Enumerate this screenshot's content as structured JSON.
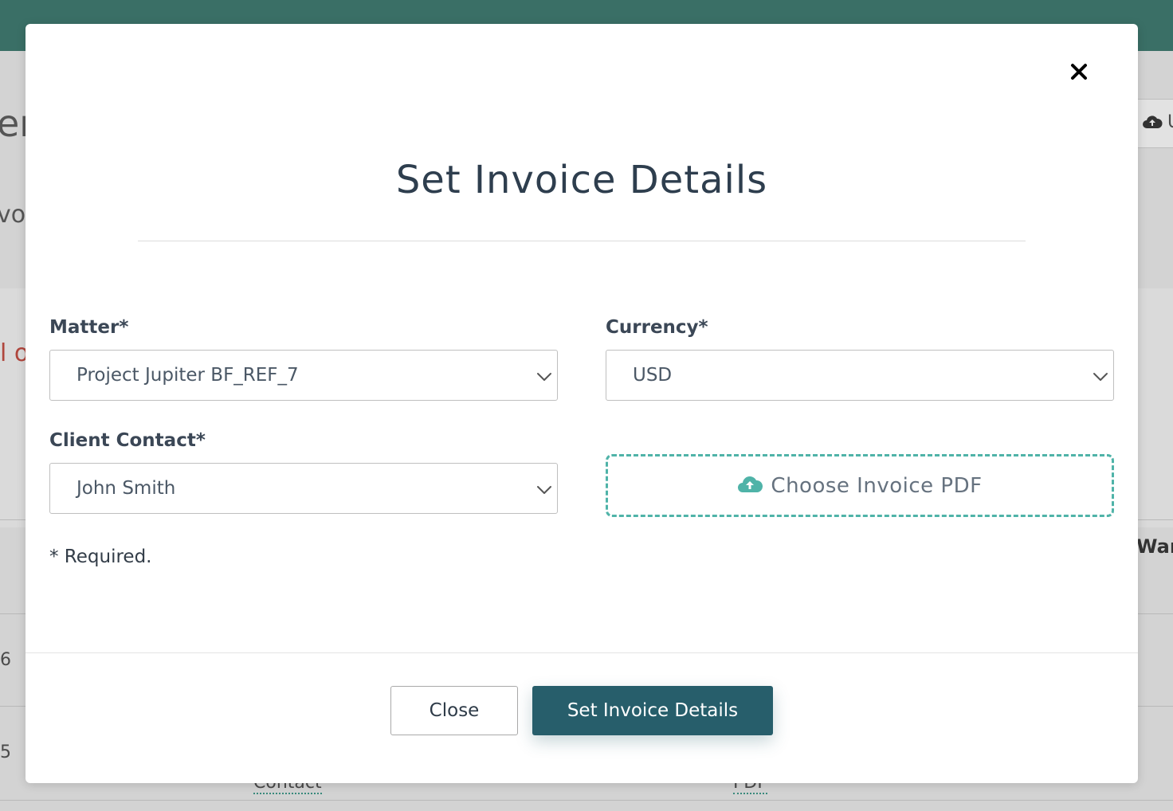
{
  "background": {
    "fragments": [
      "er",
      "vo",
      "l o",
      "Warr",
      "6",
      "5",
      "Contact",
      "PDF"
    ],
    "upload_fragment": "U"
  },
  "modal": {
    "title": "Set Invoice Details",
    "matter": {
      "label": "Matter*",
      "value": "Project Jupiter BF_REF_7"
    },
    "currency": {
      "label": "Currency*",
      "value": "USD"
    },
    "client_contact": {
      "label": "Client Contact*",
      "value": "John Smith"
    },
    "upload": {
      "label": "Choose Invoice PDF",
      "icon": "cloud-upload-icon"
    },
    "required_note": "* Required.",
    "buttons": {
      "close": "Close",
      "submit": "Set Invoice Details"
    },
    "close_icon": "close-icon"
  },
  "colors": {
    "accent": "#275e6b",
    "header": "#3a6f66",
    "upload_border": "#4fb3a8"
  }
}
